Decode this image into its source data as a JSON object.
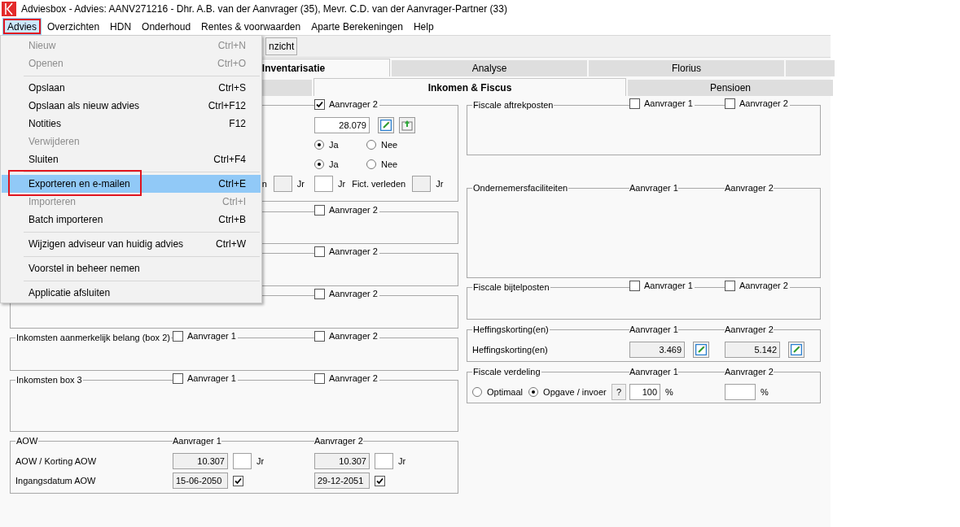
{
  "window": {
    "title": "Adviesbox - Advies: AANV271216 - Dhr. A.B. van der Aanvrager (35), Mevr. C.D. van der Aanvrager-Partner (33)"
  },
  "menu_bar": [
    {
      "label": "Advies",
      "selected": true,
      "annotated": true
    },
    {
      "label": "Overzichten",
      "selected": false,
      "annotated": false
    },
    {
      "label": "HDN",
      "selected": false,
      "annotated": false
    },
    {
      "label": "Onderhoud",
      "selected": false,
      "annotated": false
    },
    {
      "label": "Rentes & voorwaarden",
      "selected": false,
      "annotated": false
    },
    {
      "label": "Aparte Berekeningen",
      "selected": false,
      "annotated": false
    },
    {
      "label": "Help",
      "selected": false,
      "annotated": false
    }
  ],
  "dropdown": [
    {
      "kind": "item",
      "label": "Nieuw",
      "shortcut": "Ctrl+N",
      "disabled": true,
      "selected": false,
      "annotated": false
    },
    {
      "kind": "item",
      "label": "Openen",
      "shortcut": "Ctrl+O",
      "disabled": true,
      "selected": false,
      "annotated": false
    },
    {
      "kind": "separator"
    },
    {
      "kind": "item",
      "label": "Opslaan",
      "shortcut": "Ctrl+S",
      "disabled": false,
      "selected": false,
      "annotated": false
    },
    {
      "kind": "item",
      "label": "Opslaan als nieuw advies",
      "shortcut": "Ctrl+F12",
      "disabled": false,
      "selected": false,
      "annotated": false
    },
    {
      "kind": "item",
      "label": "Notities",
      "shortcut": "F12",
      "disabled": false,
      "selected": false,
      "annotated": false
    },
    {
      "kind": "item",
      "label": "Verwijderen",
      "disabled": true,
      "selected": false,
      "annotated": false
    },
    {
      "kind": "item",
      "label": "Sluiten",
      "shortcut": "Ctrl+F4",
      "disabled": false,
      "selected": false,
      "annotated": false
    },
    {
      "kind": "separator"
    },
    {
      "kind": "item",
      "label": "Exporteren en e-mailen",
      "shortcut": "Ctrl+E",
      "disabled": false,
      "selected": true,
      "annotated": true
    },
    {
      "kind": "item",
      "label": "Importeren",
      "shortcut": "Ctrl+I",
      "disabled": true,
      "selected": false,
      "annotated": false
    },
    {
      "kind": "item",
      "label": "Batch importeren",
      "shortcut": "Ctrl+B",
      "disabled": false,
      "selected": false,
      "annotated": false
    },
    {
      "kind": "separator"
    },
    {
      "kind": "item",
      "label": "Wijzigen adviseur van huidig advies",
      "shortcut": "Ctrl+W",
      "disabled": false,
      "selected": false,
      "annotated": false
    },
    {
      "kind": "separator"
    },
    {
      "kind": "item",
      "label": "Voorstel in beheer nemen",
      "disabled": false,
      "selected": false,
      "annotated": false
    },
    {
      "kind": "separator"
    },
    {
      "kind": "item",
      "label": "Applicatie afsluiten",
      "disabled": false,
      "selected": false,
      "annotated": false
    }
  ],
  "toolbar": {
    "button": "nzicht"
  },
  "tabs_row_1": [
    {
      "label": "Inventarisatie",
      "selected": true
    },
    {
      "label": "Analyse",
      "selected": false
    },
    {
      "label": "Florius",
      "selected": false
    },
    {
      "selected": false
    }
  ],
  "tabs_row_2": [
    {
      "selected": false
    },
    {
      "label": "Inkomen & Fiscus",
      "selected": true
    },
    {
      "label": "Pensioen",
      "selected": false
    }
  ],
  "left_groups": [
    {
      "applicant_2": {
        "kind": "checkbox",
        "label": "Aanvrager 2",
        "checked": true
      },
      "rows": [
        {
          "a2": [
            {
              "kind": "field",
              "value": "28.079",
              "disabled": false
            },
            {
              "kind": "edit_button"
            },
            {
              "kind": "doc_button"
            }
          ]
        },
        {
          "a2": [
            {
              "kind": "radio",
              "label": "Ja",
              "selected": true
            },
            {
              "kind": "radio",
              "label": "Nee",
              "selected": false
            }
          ]
        },
        {
          "a2": [
            {
              "kind": "radio",
              "label": "Ja",
              "selected": true
            },
            {
              "kind": "radio",
              "label": "Nee",
              "selected": false
            }
          ]
        },
        {
          "a1": [
            {
              "kind": "text",
              "text": "n"
            },
            {
              "kind": "short_field",
              "disabled": true
            },
            {
              "kind": "text",
              "text": "Jr"
            }
          ],
          "a2": [
            {
              "kind": "short_field",
              "disabled": false
            },
            {
              "kind": "text",
              "text": "Jr"
            },
            {
              "kind": "text",
              "text": "Fict. verleden"
            },
            {
              "kind": "short_field",
              "disabled": true
            },
            {
              "kind": "text",
              "text": "Jr"
            }
          ]
        }
      ]
    },
    {
      "applicant_2": {
        "kind": "checkbox",
        "label": "Aanvrager 2",
        "checked": false
      }
    },
    {
      "applicant_2": {
        "kind": "checkbox",
        "label": "Aanvrager 2",
        "checked": false
      }
    },
    {
      "applicant_2": {
        "kind": "checkbox",
        "label": "Aanvrager 2",
        "checked": false
      }
    },
    {
      "title": "Inkomsten aanmerkelijk belang (box 2)",
      "applicant_1": {
        "kind": "checkbox",
        "label": "Aanvrager 1",
        "checked": false
      },
      "applicant_2": {
        "kind": "checkbox",
        "label": "Aanvrager 2",
        "checked": false
      }
    },
    {
      "title": "Inkomsten box 3",
      "applicant_1": {
        "kind": "checkbox",
        "label": "Aanvrager 1",
        "checked": false
      },
      "applicant_2": {
        "kind": "checkbox",
        "label": "Aanvrager 2",
        "checked": false
      }
    },
    {
      "title": "AOW",
      "applicant_1": {
        "kind": "label",
        "label": "Aanvrager 1"
      },
      "applicant_2": {
        "kind": "label",
        "label": "Aanvrager 2"
      },
      "rows": [
        {
          "label": [
            {
              "kind": "text",
              "text": "AOW / Korting AOW"
            }
          ],
          "a1": [
            {
              "kind": "field",
              "value": "10.307",
              "disabled": true
            },
            {
              "kind": "short_field",
              "disabled": false
            },
            {
              "kind": "text",
              "text": "Jr"
            }
          ],
          "a2": [
            {
              "kind": "field",
              "value": "10.307",
              "disabled": true
            },
            {
              "kind": "short_field",
              "disabled": false
            },
            {
              "kind": "text",
              "text": "Jr"
            }
          ]
        },
        {
          "label": [
            {
              "kind": "text",
              "text": "Ingangsdatum AOW"
            }
          ],
          "a1": [
            {
              "kind": "date_field",
              "value": "15-06-2050",
              "disabled": true
            },
            {
              "kind": "checkbox",
              "checked": true
            }
          ],
          "a2": [
            {
              "kind": "date_field",
              "value": "29-12-2051",
              "disabled": true
            },
            {
              "kind": "checkbox",
              "checked": true
            }
          ]
        }
      ]
    }
  ],
  "right_groups": [
    {
      "title": "Fiscale aftrekposten",
      "applicant_1": {
        "kind": "checkbox",
        "label": "Aanvrager 1",
        "checked": false
      },
      "applicant_2": {
        "kind": "checkbox",
        "label": "Aanvrager 2",
        "checked": false
      }
    },
    {
      "title": "Ondernemersfaciliteiten",
      "applicant_1": {
        "kind": "label",
        "label": "Aanvrager 1"
      },
      "applicant_2": {
        "kind": "label",
        "label": "Aanvrager 2"
      }
    },
    {
      "title": "Fiscale bijtelposten",
      "applicant_1": {
        "kind": "checkbox",
        "label": "Aanvrager 1",
        "checked": false
      },
      "applicant_2": {
        "kind": "checkbox",
        "label": "Aanvrager 2",
        "checked": false
      }
    },
    {
      "title": "Heffingskorting(en)",
      "applicant_1": {
        "kind": "label",
        "label": "Aanvrager 1"
      },
      "applicant_2": {
        "kind": "label",
        "label": "Aanvrager 2"
      },
      "rows": [
        {
          "label": [
            {
              "kind": "text",
              "text": "Heffingskorting(en)"
            }
          ],
          "a1": [
            {
              "kind": "field",
              "value": "3.469",
              "disabled": true
            },
            {
              "kind": "edit_button"
            }
          ],
          "a2": [
            {
              "kind": "field",
              "value": "5.142",
              "disabled": true
            },
            {
              "kind": "edit_button"
            }
          ]
        }
      ]
    },
    {
      "title": "Fiscale verdeling",
      "applicant_1": {
        "kind": "label",
        "label": "Aanvrager 1"
      },
      "applicant_2": {
        "kind": "label",
        "label": "Aanvrager 2"
      },
      "rows": [
        {
          "label": [
            {
              "kind": "radio",
              "label": "Optimaal",
              "selected": false
            },
            {
              "kind": "radio",
              "label": "Opgave / invoer",
              "selected": true
            },
            {
              "kind": "help_button",
              "text": "?"
            }
          ],
          "a1": [
            {
              "kind": "percent_field",
              "value": "100",
              "disabled": false
            },
            {
              "kind": "text",
              "text": "%"
            }
          ],
          "a2": [
            {
              "kind": "percent_field",
              "disabled": false
            },
            {
              "kind": "text",
              "text": "%"
            }
          ]
        }
      ]
    }
  ]
}
